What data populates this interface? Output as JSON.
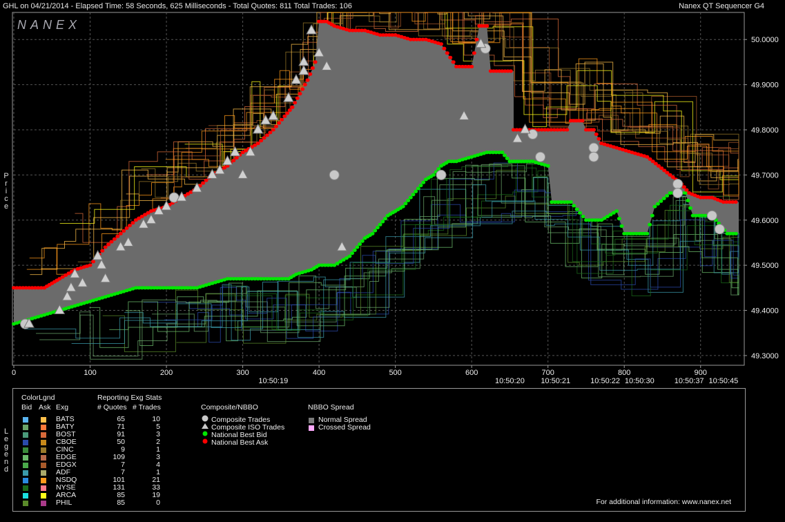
{
  "header": {
    "left": "GHL on 04/21/2014  -  Elapsed Time: 58 Seconds, 625 Milliseconds  -  Total Quotes: 811  Total Trades: 106",
    "right": "Nanex QT Sequencer G4",
    "logo": "NANEX"
  },
  "side_labels": {
    "price": "Price",
    "legend": "Legend"
  },
  "colors": {
    "bid": "#00e600",
    "ask": "#ff0000",
    "spread": "#6b6b6b",
    "grid": "#555555",
    "axis": "#9a9a9a"
  },
  "chart_data": {
    "type": "line",
    "x_range": [
      0,
      950
    ],
    "y_range": [
      49.28,
      50.06
    ],
    "x_ticks": [
      0,
      100,
      200,
      300,
      400,
      500,
      600,
      700,
      800,
      900
    ],
    "y_ticks": [
      "49.3000",
      "49.4000",
      "49.5000",
      "49.6000",
      "49.7000",
      "49.8000",
      "49.9000",
      "50.0000"
    ],
    "time_labels": [
      {
        "x": 340,
        "label": "10:50:19"
      },
      {
        "x": 650,
        "label": "10:50:20"
      },
      {
        "x": 710,
        "label": "10:50:21"
      },
      {
        "x": 775,
        "label": "10:50:22"
      },
      {
        "x": 820,
        "label": "10:50:30"
      },
      {
        "x": 885,
        "label": "10:50:37"
      },
      {
        "x": 930,
        "label": "10:50:45"
      }
    ],
    "best_ask": [
      [
        0,
        49.45
      ],
      [
        20,
        49.45
      ],
      [
        40,
        49.45
      ],
      [
        50,
        49.46
      ],
      [
        60,
        49.47
      ],
      [
        80,
        49.49
      ],
      [
        100,
        49.5
      ],
      [
        120,
        49.54
      ],
      [
        140,
        49.57
      ],
      [
        160,
        49.6
      ],
      [
        180,
        49.62
      ],
      [
        200,
        49.63
      ],
      [
        220,
        49.65
      ],
      [
        240,
        49.67
      ],
      [
        260,
        49.7
      ],
      [
        280,
        49.72
      ],
      [
        300,
        49.75
      ],
      [
        320,
        49.77
      ],
      [
        340,
        49.8
      ],
      [
        355,
        49.83
      ],
      [
        365,
        49.85
      ],
      [
        375,
        49.88
      ],
      [
        385,
        49.91
      ],
      [
        395,
        49.95
      ],
      [
        400,
        50.04
      ],
      [
        410,
        50.04
      ],
      [
        420,
        50.03
      ],
      [
        440,
        50.02
      ],
      [
        460,
        50.02
      ],
      [
        480,
        50.01
      ],
      [
        500,
        50.01
      ],
      [
        520,
        50.0
      ],
      [
        540,
        50.0
      ],
      [
        560,
        49.99
      ],
      [
        580,
        49.94
      ],
      [
        600,
        49.94
      ],
      [
        610,
        50.03
      ],
      [
        620,
        50.03
      ],
      [
        625,
        49.93
      ],
      [
        655,
        49.93
      ],
      [
        655,
        49.8
      ],
      [
        700,
        49.8
      ],
      [
        725,
        49.8
      ],
      [
        730,
        49.82
      ],
      [
        745,
        49.82
      ],
      [
        750,
        49.8
      ],
      [
        760,
        49.8
      ],
      [
        770,
        49.77
      ],
      [
        790,
        49.76
      ],
      [
        810,
        49.75
      ],
      [
        830,
        49.74
      ],
      [
        845,
        49.72
      ],
      [
        860,
        49.7
      ],
      [
        875,
        49.68
      ],
      [
        885,
        49.66
      ],
      [
        900,
        49.65
      ],
      [
        915,
        49.65
      ],
      [
        930,
        49.64
      ],
      [
        950,
        49.64
      ]
    ],
    "best_bid": [
      [
        0,
        49.37
      ],
      [
        20,
        49.38
      ],
      [
        40,
        49.39
      ],
      [
        60,
        49.4
      ],
      [
        80,
        49.41
      ],
      [
        100,
        49.42
      ],
      [
        120,
        49.43
      ],
      [
        140,
        49.44
      ],
      [
        160,
        49.45
      ],
      [
        200,
        49.45
      ],
      [
        220,
        49.45
      ],
      [
        240,
        49.45
      ],
      [
        260,
        49.46
      ],
      [
        280,
        49.47
      ],
      [
        300,
        49.47
      ],
      [
        320,
        49.47
      ],
      [
        340,
        49.47
      ],
      [
        360,
        49.47
      ],
      [
        370,
        49.48
      ],
      [
        390,
        49.49
      ],
      [
        400,
        49.5
      ],
      [
        420,
        49.5
      ],
      [
        440,
        49.52
      ],
      [
        450,
        49.54
      ],
      [
        460,
        49.56
      ],
      [
        470,
        49.57
      ],
      [
        480,
        49.59
      ],
      [
        490,
        49.61
      ],
      [
        500,
        49.62
      ],
      [
        510,
        49.63
      ],
      [
        520,
        49.65
      ],
      [
        530,
        49.67
      ],
      [
        540,
        49.69
      ],
      [
        550,
        49.7
      ],
      [
        560,
        49.72
      ],
      [
        570,
        49.73
      ],
      [
        580,
        49.73
      ],
      [
        600,
        49.74
      ],
      [
        620,
        49.75
      ],
      [
        640,
        49.75
      ],
      [
        650,
        49.73
      ],
      [
        680,
        49.73
      ],
      [
        700,
        49.72
      ],
      [
        705,
        49.64
      ],
      [
        730,
        49.64
      ],
      [
        750,
        49.6
      ],
      [
        770,
        49.6
      ],
      [
        790,
        49.62
      ],
      [
        800,
        49.57
      ],
      [
        820,
        49.57
      ],
      [
        830,
        49.57
      ],
      [
        840,
        49.63
      ],
      [
        860,
        49.66
      ],
      [
        880,
        49.66
      ],
      [
        890,
        49.61
      ],
      [
        910,
        49.61
      ],
      [
        920,
        49.6
      ],
      [
        935,
        49.57
      ],
      [
        950,
        49.57
      ]
    ],
    "trades": [
      [
        15,
        49.37
      ],
      [
        210,
        49.65
      ],
      [
        420,
        49.7
      ],
      [
        560,
        49.7
      ],
      [
        618,
        49.98
      ],
      [
        680,
        49.79
      ],
      [
        690,
        49.74
      ],
      [
        760,
        49.76
      ],
      [
        760,
        49.74
      ],
      [
        870,
        49.68
      ],
      [
        870,
        49.66
      ],
      [
        915,
        49.61
      ],
      [
        925,
        49.58
      ]
    ],
    "iso_trades": [
      [
        20,
        49.37
      ],
      [
        60,
        49.4
      ],
      [
        70,
        49.43
      ],
      [
        75,
        49.45
      ],
      [
        80,
        49.48
      ],
      [
        90,
        49.46
      ],
      [
        110,
        49.52
      ],
      [
        115,
        49.5
      ],
      [
        120,
        49.47
      ],
      [
        140,
        49.54
      ],
      [
        150,
        49.55
      ],
      [
        170,
        49.59
      ],
      [
        180,
        49.6
      ],
      [
        190,
        49.62
      ],
      [
        200,
        49.63
      ],
      [
        220,
        49.65
      ],
      [
        240,
        49.67
      ],
      [
        260,
        49.7
      ],
      [
        270,
        49.71
      ],
      [
        280,
        49.73
      ],
      [
        290,
        49.75
      ],
      [
        300,
        49.7
      ],
      [
        310,
        49.75
      ],
      [
        320,
        49.8
      ],
      [
        330,
        49.82
      ],
      [
        340,
        49.83
      ],
      [
        360,
        49.87
      ],
      [
        370,
        49.91
      ],
      [
        380,
        49.93
      ],
      [
        380,
        49.95
      ],
      [
        390,
        50.02
      ],
      [
        400,
        49.97
      ],
      [
        410,
        49.94
      ],
      [
        430,
        49.54
      ],
      [
        590,
        49.83
      ],
      [
        612,
        49.99
      ],
      [
        660,
        49.78
      ],
      [
        670,
        49.8
      ]
    ]
  },
  "legend": {
    "colorlgnd_title": "ColorLgnd",
    "col_bid": "Bid",
    "col_ask": "Ask",
    "col_exg": "Exg",
    "stats_title": "Reporting Exg Stats",
    "col_quotes": "# Quotes",
    "col_trades": "# Trades",
    "exchanges": [
      {
        "name": "BATS",
        "quotes": "65",
        "trades": "10",
        "bid": "#5ab4f0",
        "ask": "#ffc04a"
      },
      {
        "name": "BATY",
        "quotes": "71",
        "trades": "5",
        "bid": "#6aa46a",
        "ask": "#ff7a3a"
      },
      {
        "name": "BOST",
        "quotes": "91",
        "trades": "3",
        "bid": "#4a9a7a",
        "ask": "#d86a3a"
      },
      {
        "name": "CBOE",
        "quotes": "50",
        "trades": "2",
        "bid": "#2a4aaa",
        "ask": "#c88a1a"
      },
      {
        "name": "CINC",
        "quotes": "9",
        "trades": "1",
        "bid": "#3a8a3a",
        "ask": "#9a7a2a"
      },
      {
        "name": "EDGE",
        "quotes": "109",
        "trades": "3",
        "bid": "#6aba6a",
        "ask": "#b86a4a"
      },
      {
        "name": "EDGX",
        "quotes": "7",
        "trades": "4",
        "bid": "#4aaa4a",
        "ask": "#aa5a2a"
      },
      {
        "name": "ADF",
        "quotes": "7",
        "trades": "1",
        "bid": "#3a9aaa",
        "ask": "#aaaa6a"
      },
      {
        "name": "NSDQ",
        "quotes": "101",
        "trades": "21",
        "bid": "#2a8ae0",
        "ask": "#ff9a1a"
      },
      {
        "name": "NYSE",
        "quotes": "131",
        "trades": "33",
        "bid": "#1a6a1a",
        "ask": "#ff7a8a"
      },
      {
        "name": "ARCA",
        "quotes": "85",
        "trades": "19",
        "bid": "#1ae0e0",
        "ask": "#ffff1a"
      },
      {
        "name": "PHIL",
        "quotes": "85",
        "trades": "0",
        "bid": "#5a8a2a",
        "ask": "#aa3a8a"
      }
    ],
    "composite_title": "Composite/NBBO",
    "composite_items": [
      "Composite Trades",
      "Composite ISO Trades",
      "National Best Bid",
      "National Best Ask"
    ],
    "spread_title": "NBBO Spread",
    "spread_items": [
      "Normal Spread",
      "Crossed Spread"
    ],
    "footer": "For additional information: www.nanex.net"
  }
}
